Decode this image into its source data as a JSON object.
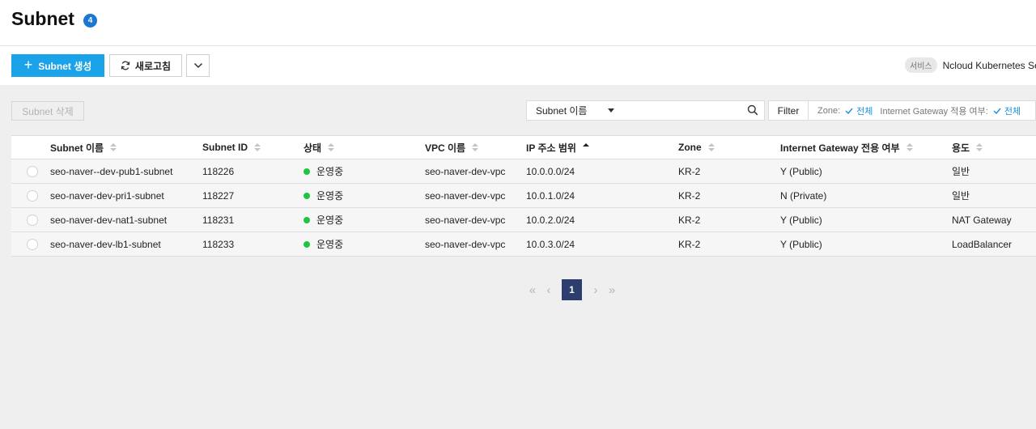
{
  "page": {
    "title": "Subnet",
    "count": "4"
  },
  "toolbar": {
    "create_label": "Subnet 생성",
    "refresh_label": "새로고침"
  },
  "service": {
    "tag": "서비스",
    "name": "Ncloud Kubernetes Serv"
  },
  "actions": {
    "delete_label": "Subnet 삭제"
  },
  "search": {
    "field": "Subnet 이름",
    "value": "",
    "filter_label": "Filter"
  },
  "filters": [
    {
      "label": "Zone:",
      "value": "전체"
    },
    {
      "label": "Internet Gateway 적용 여부:",
      "value": "전체"
    }
  ],
  "table": {
    "columns": [
      "Subnet 이름",
      "Subnet ID",
      "상태",
      "VPC 이름",
      "IP 주소 범위",
      "Zone",
      "Internet Gateway 전용 여부",
      "용도"
    ],
    "sorted_column": "IP 주소 범위",
    "sort_direction": "ascending",
    "rows": [
      {
        "name": "seo-naver--dev-pub1-subnet",
        "id": "118226",
        "status": "운영중",
        "vpc": "seo-naver-dev-vpc",
        "ip": "10.0.0.0/24",
        "zone": "KR-2",
        "igw": "Y (Public)",
        "usage": "일반"
      },
      {
        "name": "seo-naver-dev-pri1-subnet",
        "id": "118227",
        "status": "운영중",
        "vpc": "seo-naver-dev-vpc",
        "ip": "10.0.1.0/24",
        "zone": "KR-2",
        "igw": "N (Private)",
        "usage": "일반"
      },
      {
        "name": "seo-naver-dev-nat1-subnet",
        "id": "118231",
        "status": "운영중",
        "vpc": "seo-naver-dev-vpc",
        "ip": "10.0.2.0/24",
        "zone": "KR-2",
        "igw": "Y (Public)",
        "usage": "NAT Gateway"
      },
      {
        "name": "seo-naver-dev-lb1-subnet",
        "id": "118233",
        "status": "운영중",
        "vpc": "seo-naver-dev-vpc",
        "ip": "10.0.3.0/24",
        "zone": "KR-2",
        "igw": "Y (Public)",
        "usage": "LoadBalancer"
      }
    ]
  },
  "pagination": {
    "current_page": "1"
  },
  "colors": {
    "primary": "#1aa3e8",
    "badge": "#1b78d0",
    "status_running": "#1ec63f",
    "pager_active": "#2c3e6e",
    "filter_value": "#1a8fd8"
  }
}
